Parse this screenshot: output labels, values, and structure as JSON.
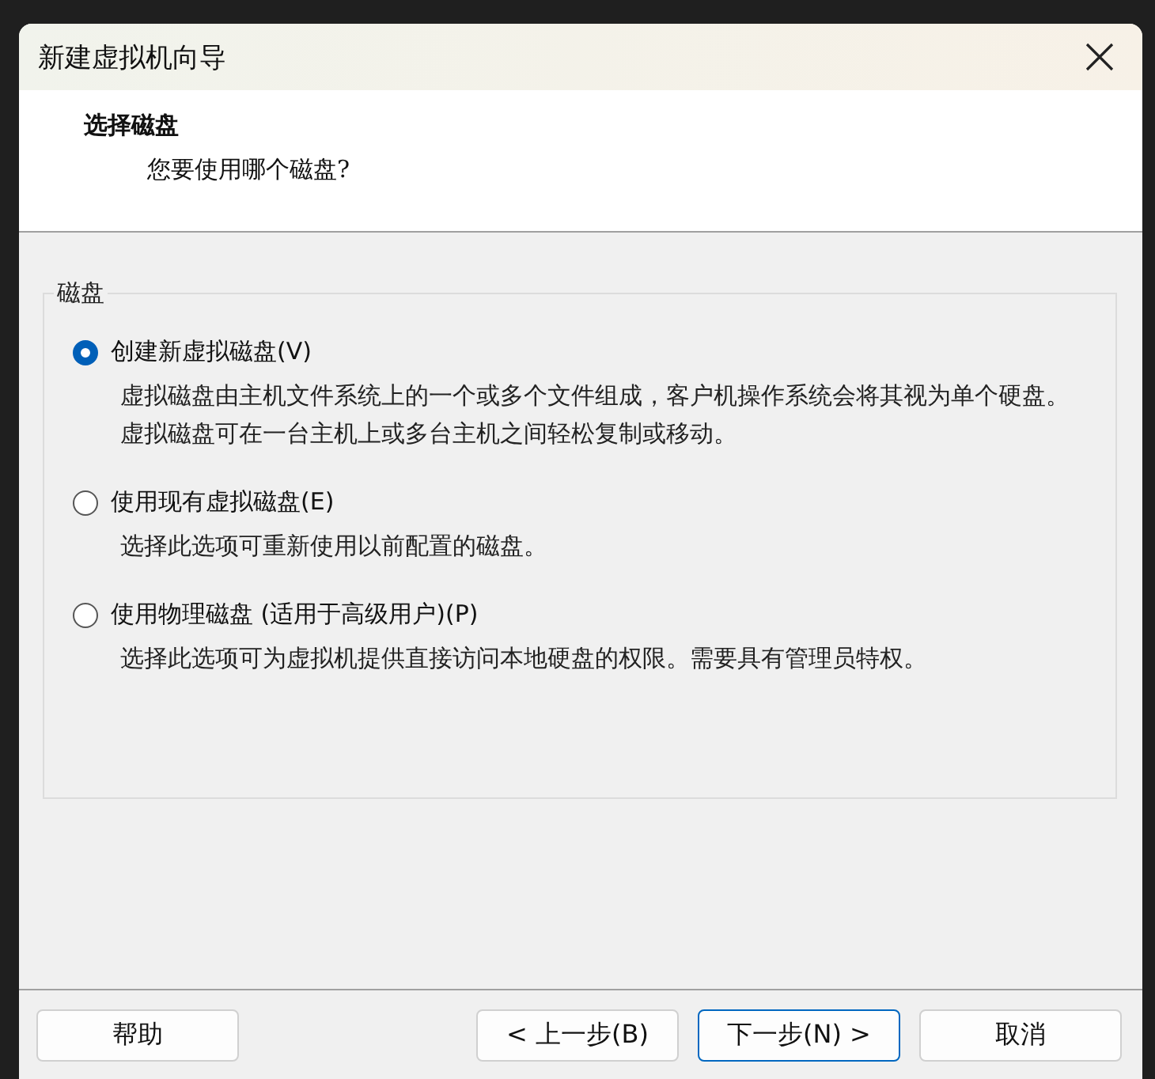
{
  "window": {
    "title": "新建虚拟机向导"
  },
  "header": {
    "title": "选择磁盘",
    "subtitle": "您要使用哪个磁盘?"
  },
  "group": {
    "label": "磁盘",
    "options": [
      {
        "label": "创建新虚拟磁盘(V)",
        "selected": true,
        "description": "虚拟磁盘由主机文件系统上的一个或多个文件组成，客户机操作系统会将其视为单个硬盘。虚拟磁盘可在一台主机上或多台主机之间轻松复制或移动。"
      },
      {
        "label": "使用现有虚拟磁盘(E)",
        "selected": false,
        "description": "选择此选项可重新使用以前配置的磁盘。"
      },
      {
        "label": "使用物理磁盘 (适用于高级用户)(P)",
        "selected": false,
        "description": "选择此选项可为虚拟机提供直接访问本地硬盘的权限。需要具有管理员特权。"
      }
    ]
  },
  "buttons": [
    {
      "label": "帮助",
      "default": false
    },
    {
      "label": "< 上一步(B)",
      "default": false
    },
    {
      "label": "下一步(N) >",
      "default": true
    },
    {
      "label": "取消",
      "default": false
    }
  ]
}
